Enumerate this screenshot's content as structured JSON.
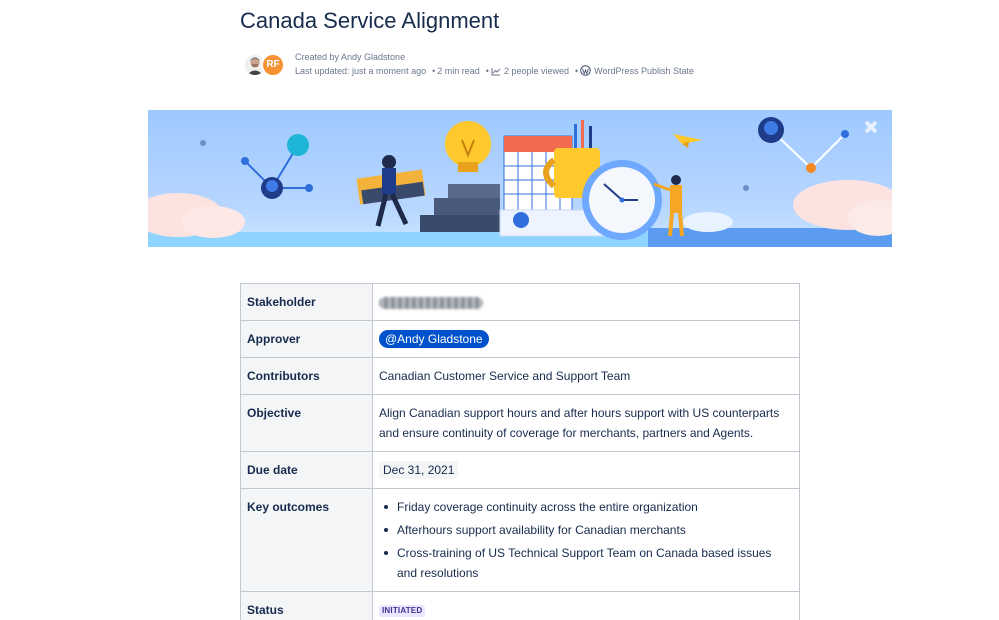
{
  "page": {
    "title": "Canada Service Alignment"
  },
  "byline": {
    "avatars": [
      {
        "name": "avatar-photo",
        "initials": ""
      },
      {
        "name": "avatar-rf",
        "initials": "RF"
      }
    ],
    "created_by": "Created by Andy Gladstone",
    "last_updated": "Last updated: just a moment ago",
    "read_time": "2 min read",
    "views": "2 people viewed",
    "publish_state": "WordPress Publish State",
    "icons": [
      "chart-icon",
      "wordpress-icon"
    ]
  },
  "banner": {
    "image": "office-productivity-illustration"
  },
  "table": {
    "rows": {
      "stakeholder": {
        "key": "Stakeholder"
      },
      "approver": {
        "key": "Approver",
        "value": "@Andy Gladstone"
      },
      "contributors": {
        "key": "Contributors",
        "value": "Canadian Customer Service and Support Team"
      },
      "objective": {
        "key": "Objective",
        "value": "Align Canadian support hours and after hours support with US counterparts and ensure continuity of coverage for merchants, partners and Agents."
      },
      "due_date": {
        "key": "Due date",
        "value": "Dec 31, 2021"
      },
      "key_outcomes": {
        "key": "Key outcomes",
        "items": [
          "Friday coverage continuity across the entire organization",
          "Afterhours support availability for Canadian merchants",
          "Cross-training of US Technical Support Team on Canada based issues and resolutions"
        ]
      },
      "status": {
        "key": "Status",
        "value": "INITIATED"
      }
    }
  },
  "colors": {
    "mention_bg": "#0052cc",
    "status_bg": "#eae6ff",
    "status_text": "#403294",
    "avatar_rf": "#f79232"
  }
}
